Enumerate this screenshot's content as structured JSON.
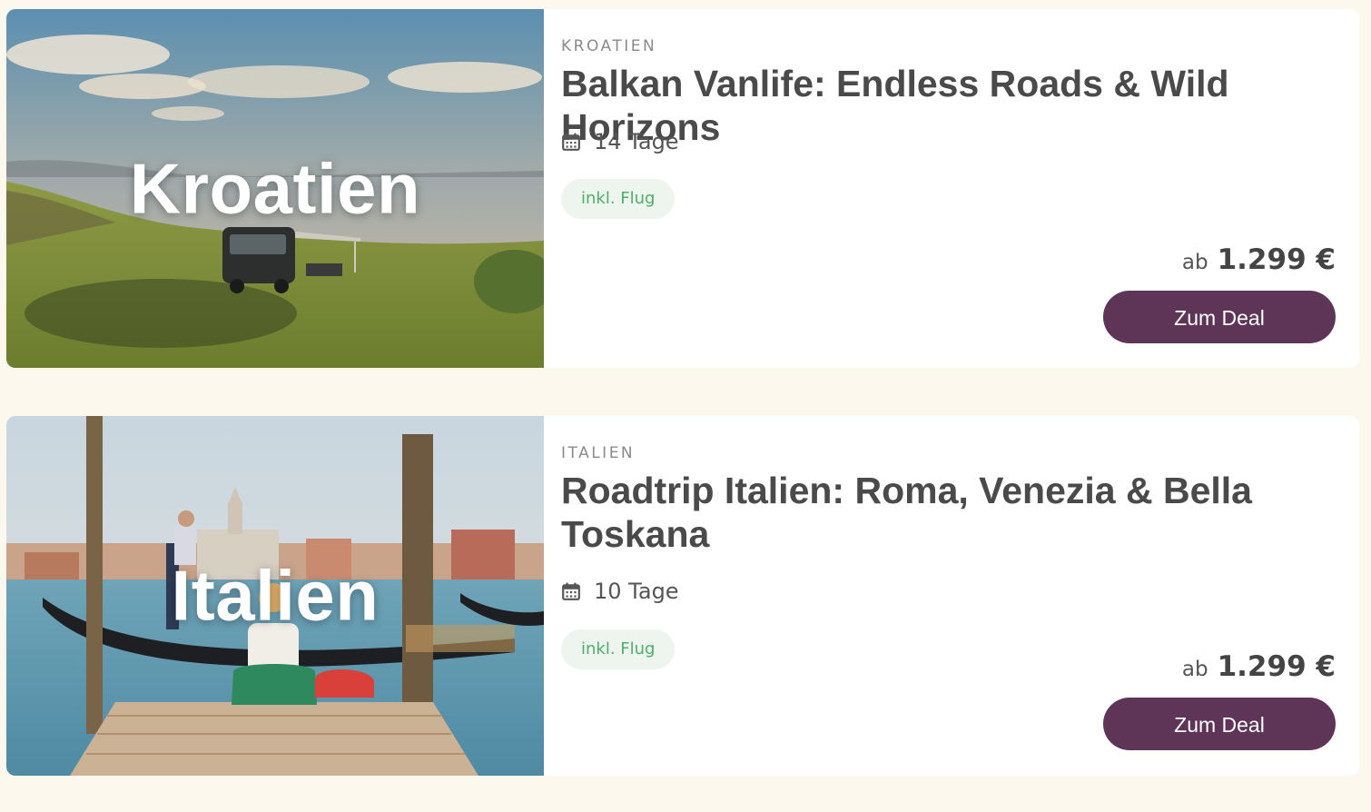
{
  "deals": [
    {
      "image_label": "Kroatien",
      "country": "KROATIEN",
      "title": "Balkan Vanlife: Endless Roads & Wild Horizons",
      "duration": "14 Tage",
      "badge": "inkl. Flug",
      "price_prefix": "ab",
      "price": "1.299 €",
      "button_label": "Zum Deal"
    },
    {
      "image_label": "Italien",
      "country": "ITALIEN",
      "title": "Roadtrip Italien: Roma, Venezia & Bella Toskana",
      "duration": "10 Tage",
      "badge": "inkl. Flug",
      "price_prefix": "ab",
      "price": "1.299 €",
      "button_label": "Zum Deal"
    }
  ],
  "colors": {
    "page_background": "#fdf8ee",
    "card_background": "#ffffff",
    "button": "#5e3557",
    "badge_background": "#eef5ee",
    "badge_text": "#4caf6a",
    "title_text": "#4a4a4a"
  },
  "icons": {
    "duration": "calendar-icon"
  }
}
